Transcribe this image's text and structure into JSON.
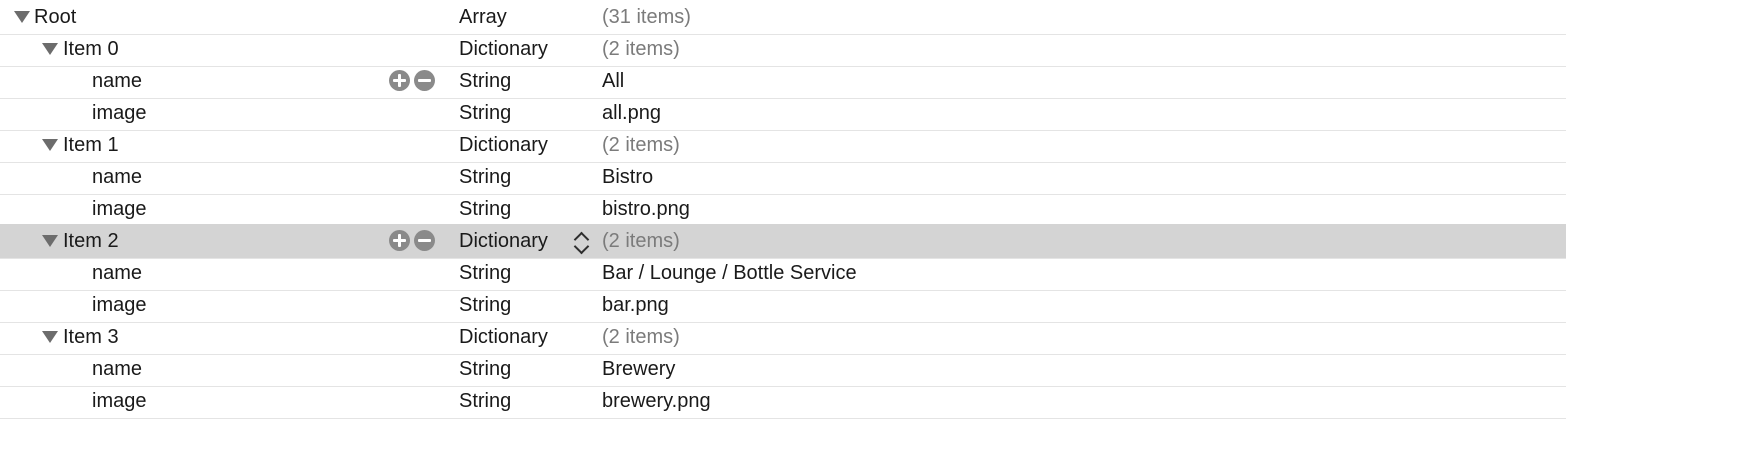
{
  "plist": {
    "rows": [
      {
        "key": "Root",
        "type": "Array",
        "value": "(31 items)"
      },
      {
        "key": "Item 0",
        "type": "Dictionary",
        "value": "(2 items)"
      },
      {
        "key": "name",
        "type": "String",
        "value": "All"
      },
      {
        "key": "image",
        "type": "String",
        "value": "all.png"
      },
      {
        "key": "Item 1",
        "type": "Dictionary",
        "value": "(2 items)"
      },
      {
        "key": "name",
        "type": "String",
        "value": "Bistro"
      },
      {
        "key": "image",
        "type": "String",
        "value": "bistro.png"
      },
      {
        "key": "Item 2",
        "type": "Dictionary",
        "value": "(2 items)"
      },
      {
        "key": "name",
        "type": "String",
        "value": "Bar / Lounge / Bottle Service"
      },
      {
        "key": "image",
        "type": "String",
        "value": "bar.png"
      },
      {
        "key": "Item 3",
        "type": "Dictionary",
        "value": "(2 items)"
      },
      {
        "key": "name",
        "type": "String",
        "value": "Brewery"
      },
      {
        "key": "image",
        "type": "String",
        "value": "brewery.png"
      }
    ],
    "selected_row": "Item 2"
  },
  "icons": {
    "disclosure": "disclosure-triangle-icon",
    "add": "plus-circle-icon",
    "remove": "minus-circle-icon",
    "type_popup": "up-down-chevron-icon"
  },
  "colors": {
    "selected_row_bg": "#d4d4d4",
    "count_text": "#7b7b7b",
    "row_divider": "#e4e4e4"
  }
}
